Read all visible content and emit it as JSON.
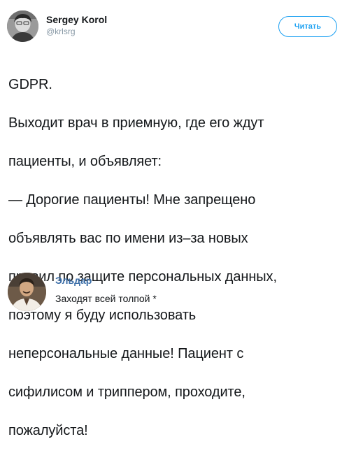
{
  "tweet": {
    "author_name": "Sergey Korol",
    "author_handle": "@krlsrg",
    "follow_label": "Читать",
    "text_lines": [
      "GDPR.",
      "Выходит врач в приемную, где его ждут",
      "пациенты, и объявляет:",
      "— Дорогие пациенты! Мне запрещено",
      "объявлять вас по имени из–за новых",
      "правил по защите персональных данных,",
      "поэтому я буду использовать",
      "неперсональные данные! Пациент с",
      "сифилисом и триппером, проходите,",
      "пожалуйста!"
    ]
  },
  "reply": {
    "author_name": "Эльдар",
    "text": "Заходят всей толпой *"
  },
  "colors": {
    "accent": "#1da1f2",
    "reply_name": "#3b6ea8",
    "text": "#14171a",
    "muted": "#8899a6"
  },
  "icons": {
    "tweet_avatar": "avatar-photo",
    "reply_avatar": "avatar-photo"
  }
}
